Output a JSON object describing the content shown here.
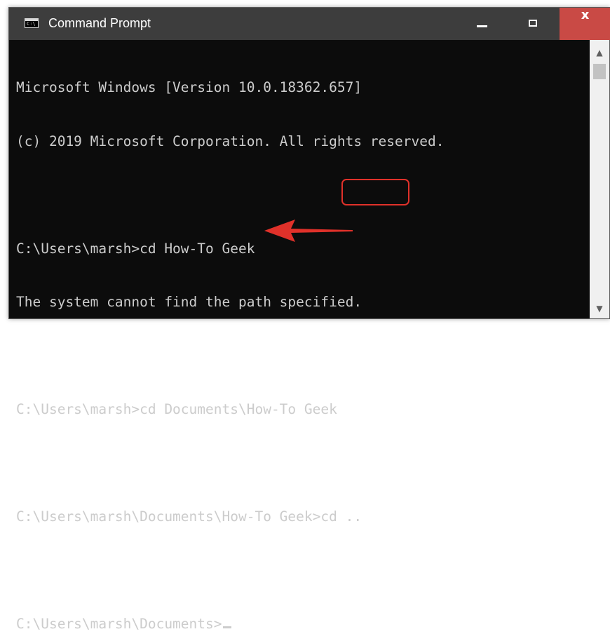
{
  "window": {
    "title": "Command Prompt",
    "icon": "cmd-icon"
  },
  "titlebar_buttons": {
    "minimize": "minimize-icon",
    "maximize": "maximize-icon",
    "close_label": "x"
  },
  "console": {
    "lines": [
      "Microsoft Windows [Version 10.0.18362.657]",
      "(c) 2019 Microsoft Corporation. All rights reserved.",
      "",
      "C:\\Users\\marsh>cd How-To Geek",
      "The system cannot find the path specified.",
      "",
      "C:\\Users\\marsh>cd Documents\\How-To Geek",
      "",
      "C:\\Users\\marsh\\Documents\\How-To Geek>cd ..",
      "",
      "C:\\Users\\marsh\\Documents>"
    ]
  },
  "annotations": {
    "highlight_color": "#e0312a",
    "arrow_color": "#e0312a"
  },
  "colors": {
    "console_bg": "#0c0c0c",
    "console_text": "#cccccc",
    "titlebar_bg": "#3d3d3d",
    "close_bg": "#c94a45"
  }
}
